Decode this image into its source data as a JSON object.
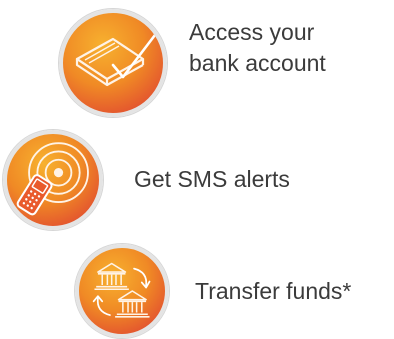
{
  "features": [
    {
      "icon": "bank-card-check-icon",
      "label_line1": "Access your",
      "label_line2": "bank account"
    },
    {
      "icon": "mobile-phone-signal-icon",
      "label_line1": "Get SMS alerts"
    },
    {
      "icon": "bank-transfer-icon",
      "label_line1": "Transfer funds*"
    }
  ],
  "colors": {
    "badge_light": "#f7b12f",
    "badge_mid": "#f08a25",
    "badge_dark": "#d8352d",
    "badge_ring": "#e4e4e4",
    "text": "#3b3b3b"
  }
}
